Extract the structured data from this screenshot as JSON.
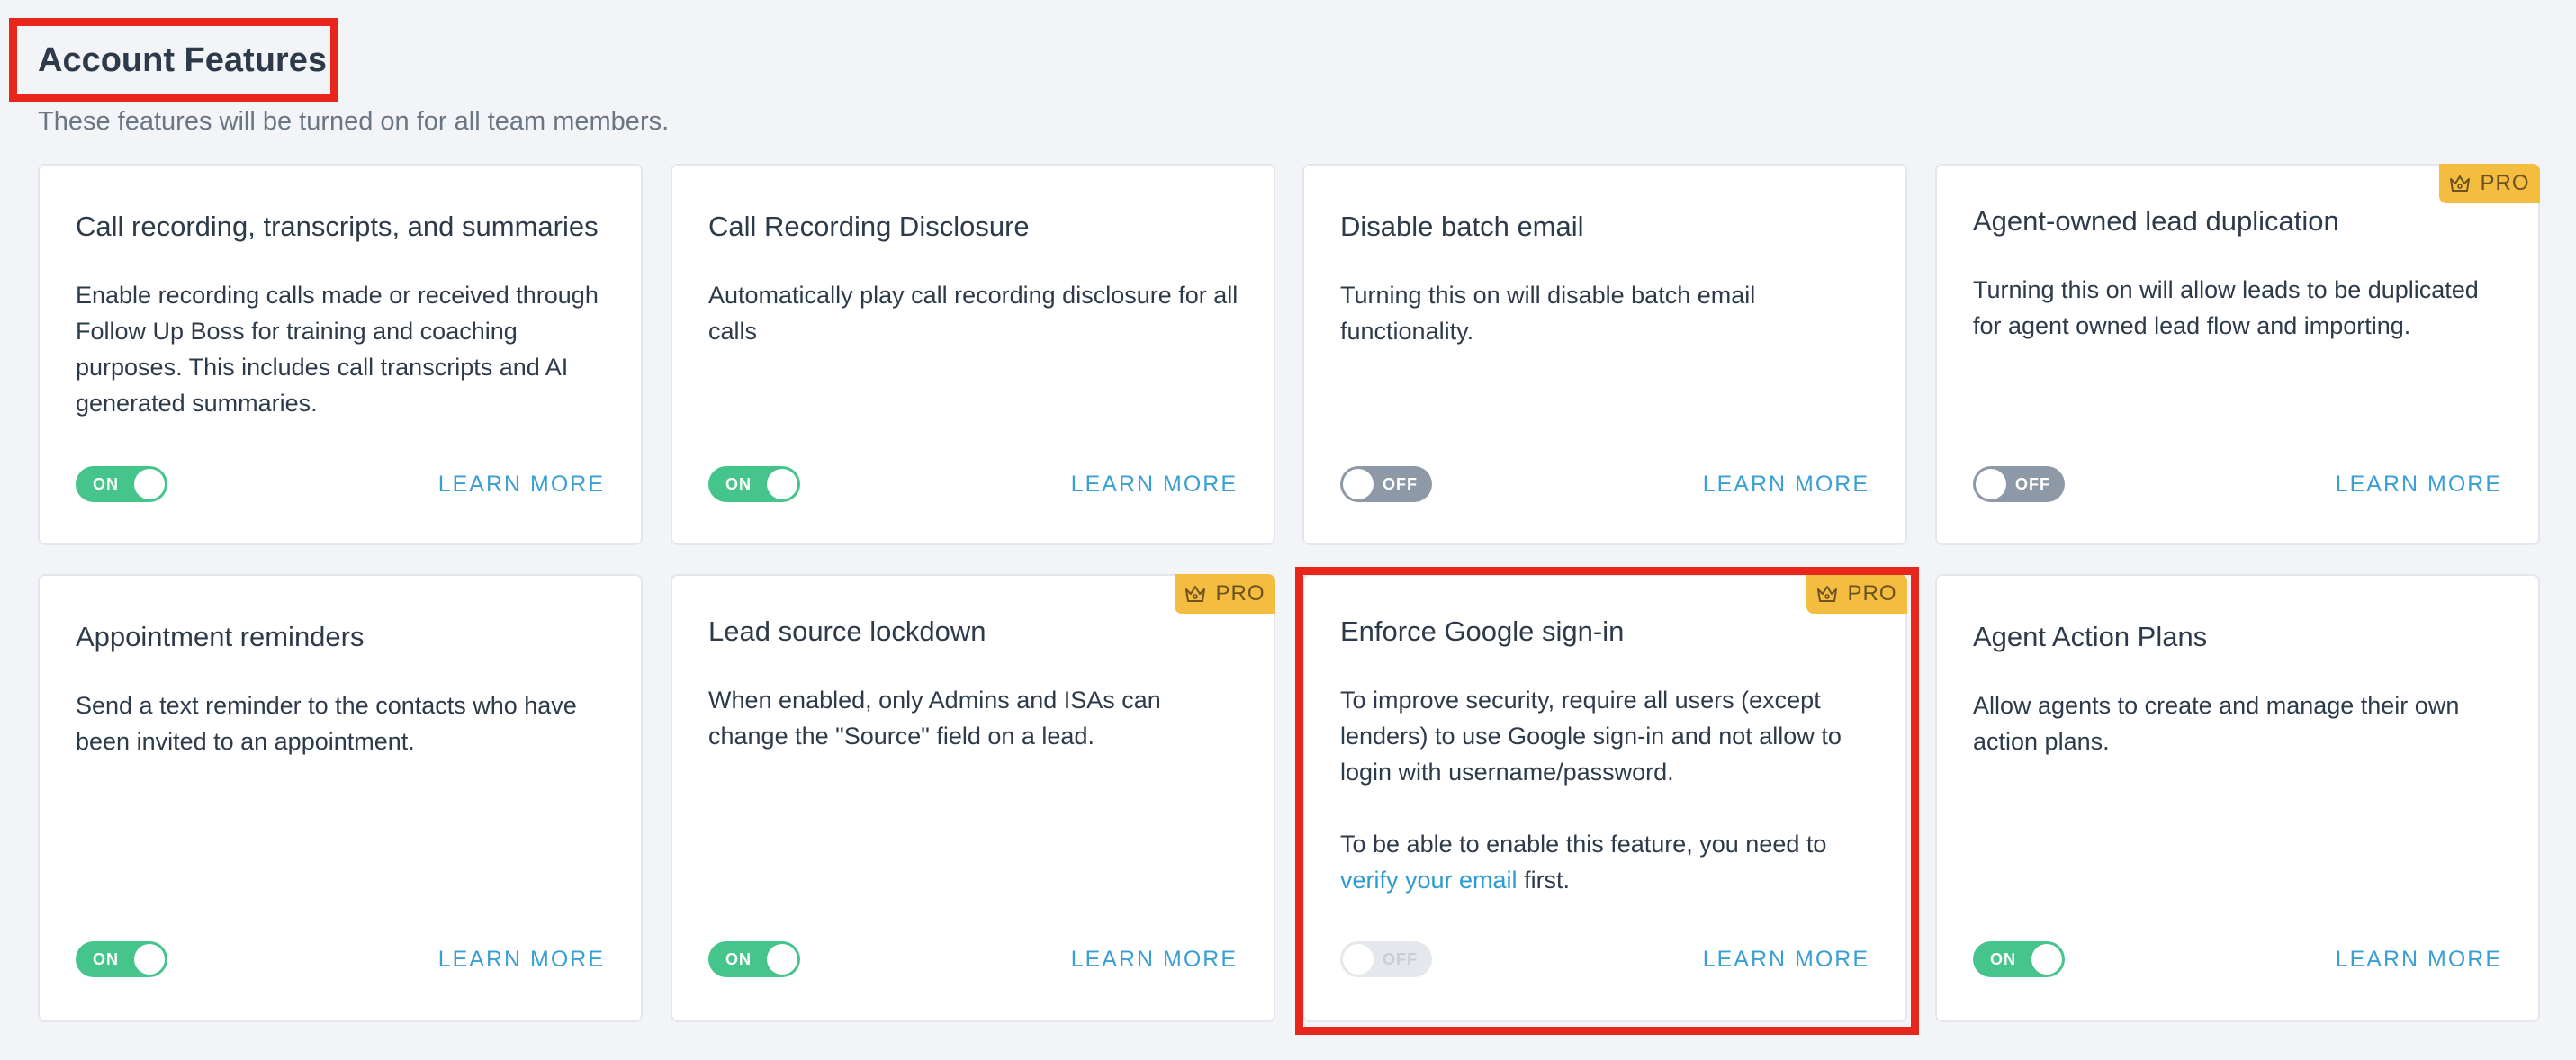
{
  "header": {
    "title": "Account Features",
    "subtitle": "These features will be turned on for all team members."
  },
  "common": {
    "learn_more": "LEARN MORE",
    "pro": "PRO",
    "on": "ON",
    "off": "OFF"
  },
  "features": [
    {
      "title": "Call recording, transcripts, and summaries",
      "description": "Enable recording calls made or received through Follow Up Boss for training and coaching purposes. This includes call transcripts and AI generated summaries.",
      "toggle_state": "on",
      "pro": false
    },
    {
      "title": "Call Recording Disclosure",
      "description": "Automatically play call recording disclosure for all calls",
      "toggle_state": "on",
      "pro": false
    },
    {
      "title": "Disable batch email",
      "description": "Turning this on will disable batch email functionality.",
      "toggle_state": "off",
      "pro": false
    },
    {
      "title": "Agent-owned lead duplication",
      "description": "Turning this on will allow leads to be duplicated for agent owned lead flow and importing.",
      "toggle_state": "off",
      "pro": true
    },
    {
      "title": "Appointment reminders",
      "description": "Send a text reminder to the contacts who have been invited to an appointment.",
      "toggle_state": "on",
      "pro": false
    },
    {
      "title": "Lead source lockdown",
      "description": "When enabled, only Admins and ISAs can change the \"Source\" field on a lead.",
      "toggle_state": "on",
      "pro": true
    },
    {
      "title": "Enforce Google sign-in",
      "description": "To improve security, require all users (except lenders) to use Google sign-in and not allow to login with username/password.",
      "note_before": "To be able to enable this feature, you need to ",
      "note_link": "verify your email",
      "note_after": " first.",
      "toggle_state": "disabled",
      "pro": true
    },
    {
      "title": "Agent Action Plans",
      "description": "Allow agents to create and manage their own action plans.",
      "toggle_state": "on",
      "pro": false
    }
  ],
  "colors": {
    "toggle_on": "#45c48c",
    "toggle_off": "#8e99a8",
    "link": "#3a9fd4",
    "pro_badge": "#f5bd3f",
    "highlight": "#e8261c"
  }
}
